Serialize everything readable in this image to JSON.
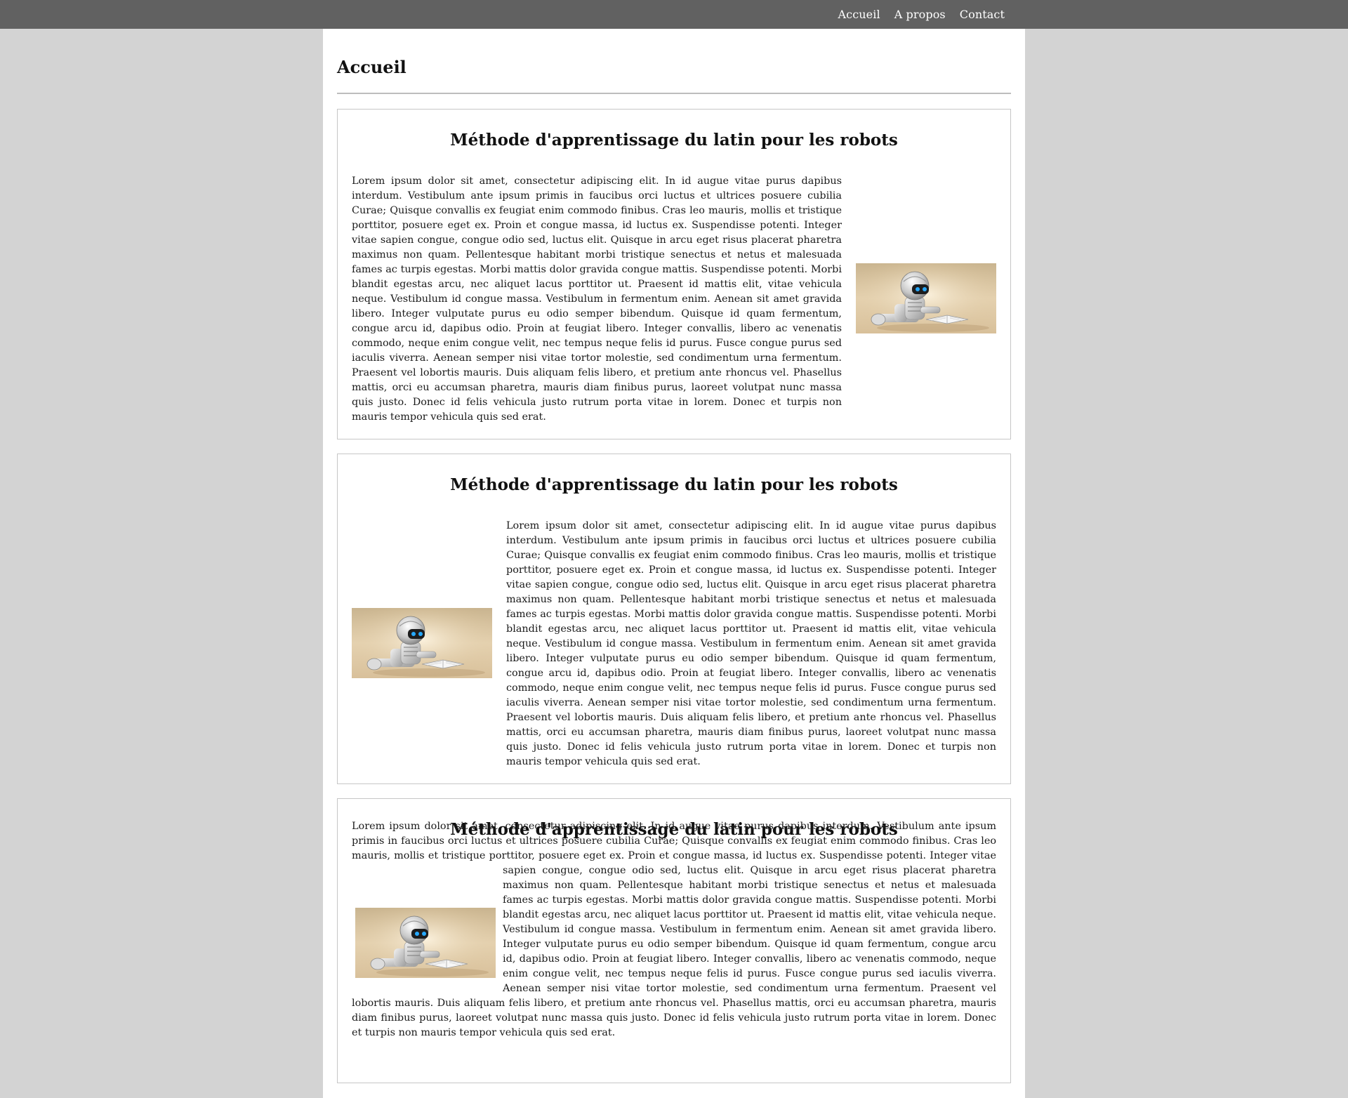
{
  "nav": {
    "items": [
      "Accueil",
      "A propos",
      "Contact"
    ]
  },
  "page": {
    "title": "Accueil"
  },
  "articles": [
    {
      "title": "Méthode d'apprentissage du latin pour les robots",
      "text": "Lorem ipsum dolor sit amet, consectetur adipiscing elit. In id augue vitae purus dapibus interdum. Vestibulum ante ipsum primis in faucibus orci luctus et ultrices posuere cubilia Curae; Quisque convallis ex feugiat enim commodo finibus. Cras leo mauris, mollis et tristique porttitor, posuere eget ex. Proin et congue massa, id luctus ex. Suspendisse potenti. Integer vitae sapien congue, congue odio sed, luctus elit. Quisque in arcu eget risus placerat pharetra maximus non quam. Pellentesque habitant morbi tristique senectus et netus et malesuada fames ac turpis egestas. Morbi mattis dolor gravida congue mattis. Suspendisse potenti. Morbi blandit egestas arcu, nec aliquet lacus porttitor ut. Praesent id mattis elit, vitae vehicula neque. Vestibulum id congue massa. Vestibulum in fermentum enim. Aenean sit amet gravida libero. Integer vulputate purus eu odio semper bibendum. Quisque id quam fermentum, congue arcu id, dapibus odio. Proin at feugiat libero. Integer convallis, libero ac venenatis commodo, neque enim congue velit, nec tempus neque felis id purus. Fusce congue purus sed iaculis viverra. Aenean semper nisi vitae tortor molestie, sed condimentum urna fermentum. Praesent vel lobortis mauris. Duis aliquam felis libero, et pretium ante rhoncus vel. Phasellus mattis, orci eu accumsan pharetra, mauris diam finibus purus, laoreet volutpat nunc massa quis justo. Donec id felis vehicula justo rutrum porta vitae in lorem. Donec et turpis non mauris tempor vehicula quis sed erat.",
      "image_side": "right"
    },
    {
      "title": "Méthode d'apprentissage du latin pour les robots",
      "text": "Lorem ipsum dolor sit amet, consectetur adipiscing elit. In id augue vitae purus dapibus interdum. Vestibulum ante ipsum primis in faucibus orci luctus et ultrices posuere cubilia Curae; Quisque convallis ex feugiat enim commodo finibus. Cras leo mauris, mollis et tristique porttitor, posuere eget ex. Proin et congue massa, id luctus ex. Suspendisse potenti. Integer vitae sapien congue, congue odio sed, luctus elit. Quisque in arcu eget risus placerat pharetra maximus non quam. Pellentesque habitant morbi tristique senectus et netus et malesuada fames ac turpis egestas. Morbi mattis dolor gravida congue mattis. Suspendisse potenti. Morbi blandit egestas arcu, nec aliquet lacus porttitor ut. Praesent id mattis elit, vitae vehicula neque. Vestibulum id congue massa. Vestibulum in fermentum enim. Aenean sit amet gravida libero. Integer vulputate purus eu odio semper bibendum. Quisque id quam fermentum, congue arcu id, dapibus odio. Proin at feugiat libero. Integer convallis, libero ac venenatis commodo, neque enim congue velit, nec tempus neque felis id purus. Fusce congue purus sed iaculis viverra. Aenean semper nisi vitae tortor molestie, sed condimentum urna fermentum. Praesent vel lobortis mauris. Duis aliquam felis libero, et pretium ante rhoncus vel. Phasellus mattis, orci eu accumsan pharetra, mauris diam finibus purus, laoreet volutpat nunc massa quis justo. Donec id felis vehicula justo rutrum porta vitae in lorem. Donec et turpis non mauris tempor vehicula quis sed erat.",
      "image_side": "left"
    },
    {
      "title": "Méthode d'apprentissage du latin pour les robots",
      "text": "Lorem ipsum dolor sit amet, consectetur adipiscing elit. In id augue vitae purus dapibus interdum. Vestibulum ante ipsum primis in faucibus orci luctus et ultrices posuere cubilia Curae; Quisque convallis ex feugiat enim commodo finibus. Cras leo mauris, mollis et tristique porttitor, posuere eget ex. Proin et congue massa, id luctus ex. Suspendisse potenti. Integer vitae sapien congue, congue odio sed, luctus elit. Quisque in arcu eget risus placerat pharetra maximus non quam. Pellentesque habitant morbi tristique senectus et netus et malesuada fames ac turpis egestas. Morbi mattis dolor gravida congue mattis. Suspendisse potenti. Morbi blandit egestas arcu, nec aliquet lacus porttitor ut. Praesent id mattis elit, vitae vehicula neque. Vestibulum id congue massa. Vestibulum in fermentum enim. Aenean sit amet gravida libero. Integer vulputate purus eu odio semper bibendum. Quisque id quam fermentum, congue arcu id, dapibus odio. Proin at feugiat libero. Integer convallis, libero ac venenatis commodo, neque enim congue velit, nec tempus neque felis id purus. Fusce congue purus sed iaculis viverra. Aenean semper nisi vitae tortor molestie, sed condimentum urna fermentum. Praesent vel lobortis mauris. Duis aliquam felis libero, et pretium ante rhoncus vel. Phasellus mattis, orci eu accumsan pharetra, mauris diam finibus purus, laoreet volutpat nunc massa quis justo. Donec id felis vehicula justo rutrum porta vitae in lorem. Donec et turpis non mauris tempor vehicula quis sed erat.",
      "image_side": "inline-float-left"
    }
  ],
  "image": {
    "icon": "robot-reading-book-image"
  },
  "colors": {
    "page_background": "#d3d3d3",
    "topbar": "#616161",
    "content_background": "#ffffff",
    "card_border": "#c6c6c6"
  }
}
